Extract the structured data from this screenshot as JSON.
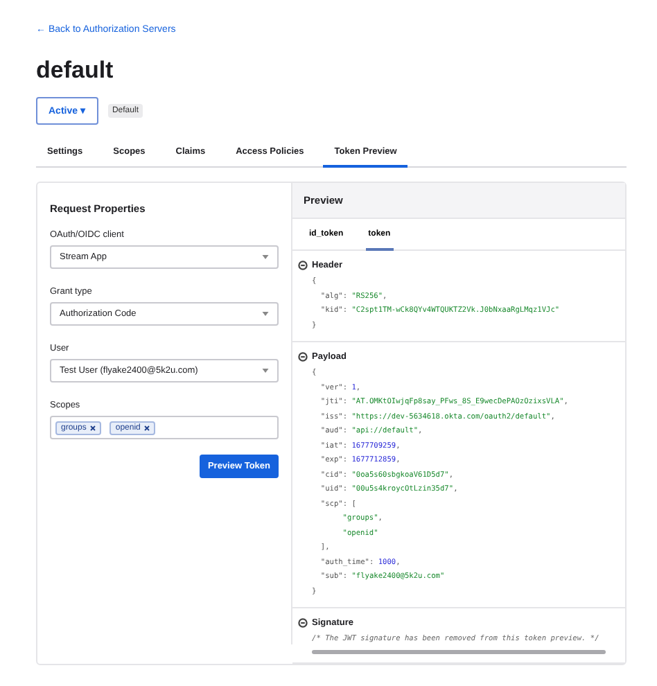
{
  "back_link": "← Back to Authorization Servers",
  "title": "default",
  "status_button": "Active ▾",
  "badge": "Default",
  "tabs": [
    {
      "label": "Settings",
      "selected": false
    },
    {
      "label": "Scopes",
      "selected": false
    },
    {
      "label": "Claims",
      "selected": false
    },
    {
      "label": "Access Policies",
      "selected": false
    },
    {
      "label": "Token Preview",
      "selected": true
    }
  ],
  "request": {
    "title": "Request Properties",
    "fields": [
      {
        "label": "OAuth/OIDC client",
        "value": "Stream App"
      },
      {
        "label": "Grant type",
        "value": "Authorization Code"
      },
      {
        "label": "User",
        "value": "Test User (flyake2400@5k2u.com)"
      }
    ],
    "scopes_label": "Scopes",
    "scopes": [
      "groups",
      "openid"
    ],
    "button": "Preview Token"
  },
  "preview": {
    "title": "Preview",
    "tabs": [
      {
        "label": "id_token",
        "selected": false
      },
      {
        "label": "token",
        "selected": true
      }
    ],
    "sections": [
      {
        "title": "Header",
        "expanded": true,
        "lines": [
          {
            "key": "{"
          },
          {
            "key": "  \"alg\": ",
            "value": "\"RS256\"",
            "kind": "string",
            "end": ","
          },
          {
            "key": "  \"kid\": ",
            "value": "\"C2spt1TM-wCk8QYv4WTQUKTZ2Vk.J0bNxaaRgLMqz1VJc\"",
            "kind": "string"
          },
          {
            "key": "}"
          }
        ]
      },
      {
        "title": "Payload",
        "expanded": true,
        "lines": [
          {
            "key": "{"
          },
          {
            "key": "  \"ver\": ",
            "value": "1",
            "kind": "number",
            "end": ","
          },
          {
            "key": "  \"jti\": ",
            "value": "\"AT.OMKtOIwjqFp8say_PFws_8S_E9wecDePAOzOzixsVLA\"",
            "kind": "string",
            "end": ","
          },
          {
            "key": "  \"iss\": ",
            "value": "\"https://dev-5634618.okta.com/oauth2/default\"",
            "kind": "string",
            "end": ","
          },
          {
            "key": "  \"aud\": ",
            "value": "\"api://default\"",
            "kind": "string",
            "end": ","
          },
          {
            "key": "  \"iat\": ",
            "value": "1677709259",
            "kind": "number",
            "end": ","
          },
          {
            "key": "  \"exp\": ",
            "value": "1677712859",
            "kind": "number",
            "end": ","
          },
          {
            "key": "  \"cid\": ",
            "value": "\"0oa5s60sbgkoaV61D5d7\"",
            "kind": "string",
            "end": ","
          },
          {
            "key": "  \"uid\": ",
            "value": "\"00u5s4kroycOtLzin35d7\"",
            "kind": "string",
            "end": ","
          },
          {
            "key": "  \"scp\": ["
          },
          {
            "value": "\"groups\"",
            "kind": "item",
            "end": ","
          },
          {
            "value": "\"openid\"",
            "kind": "item"
          },
          {
            "key": "  ],"
          },
          {
            "key": "  \"auth_time\": ",
            "value": "1000",
            "kind": "number",
            "end": ","
          },
          {
            "key": "  \"sub\": ",
            "value": "\"flyake2400@5k2u.com\"",
            "kind": "string"
          },
          {
            "key": "}"
          }
        ]
      },
      {
        "title": "Signature",
        "expanded": true,
        "comment": "/* The JWT signature has been removed from this token preview. */"
      }
    ]
  }
}
